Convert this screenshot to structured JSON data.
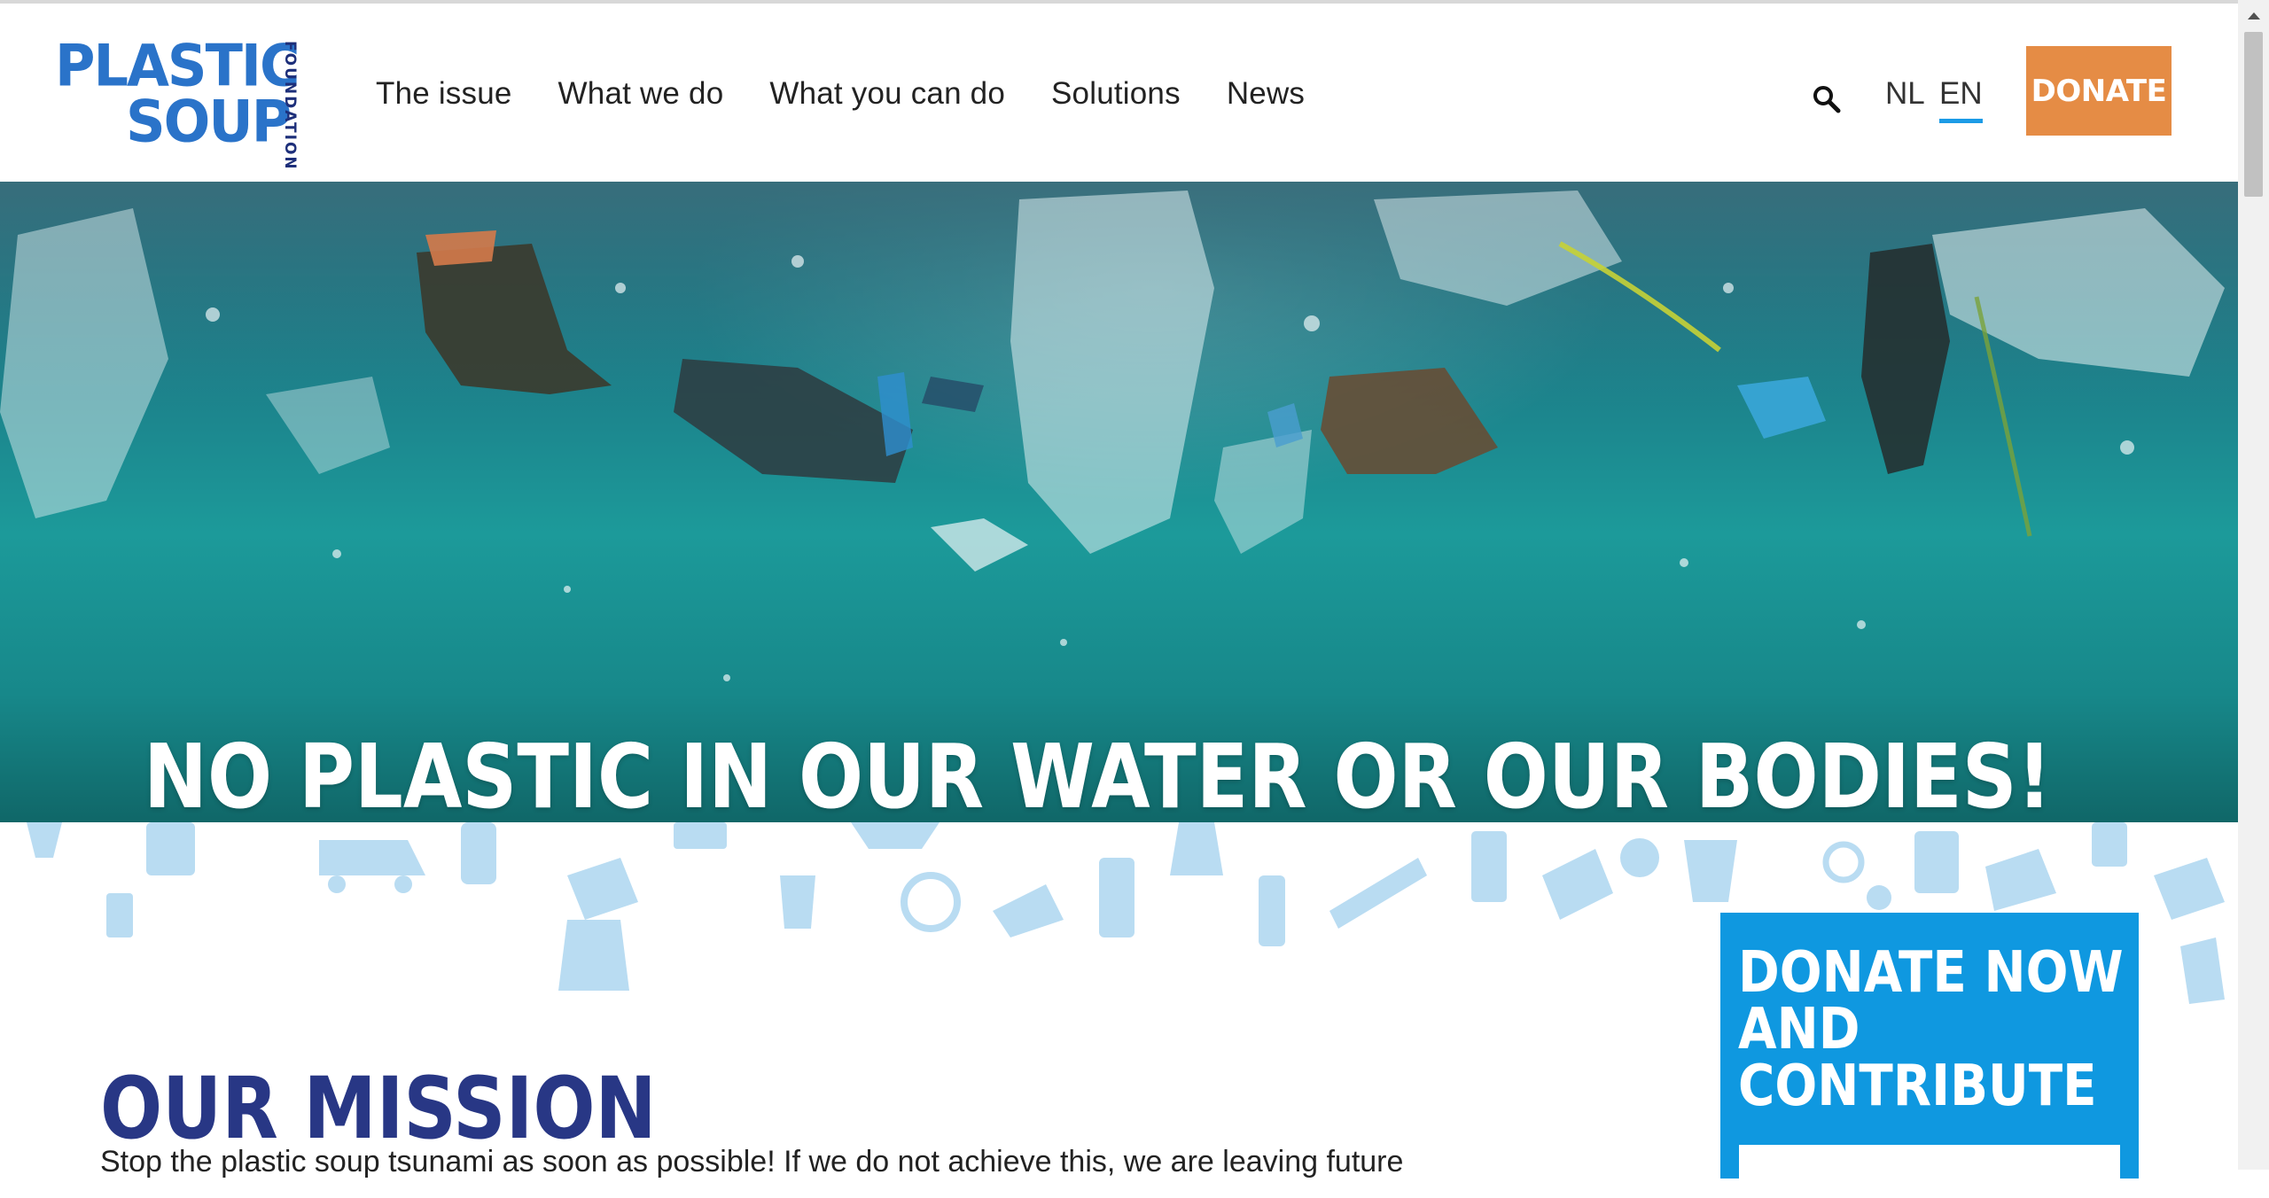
{
  "header": {
    "logo": {
      "line1": "PLASTIC",
      "line2": "SOUP",
      "vertical": "FOUNDATION"
    },
    "nav": [
      "The issue",
      "What we do",
      "What you can do",
      "Solutions",
      "News"
    ],
    "search_icon": "search-icon",
    "languages": {
      "nl": "NL",
      "en": "EN",
      "active": "EN"
    },
    "donate_label": "DONATE"
  },
  "hero": {
    "title": "NO PLASTIC IN OUR WATER OR OUR BODIES!"
  },
  "mission": {
    "title": "OUR MISSION",
    "text": "Stop the plastic soup tsunami as soon as possible! If we do not achieve this, we are leaving future"
  },
  "donate_box": {
    "title": "DONATE NOW\nAND\nCONTRIBUTE"
  },
  "colors": {
    "brand_blue": "#2a73c9",
    "navy": "#283785",
    "orange": "#e58c45",
    "accent_blue": "#0f98e0",
    "pattern_blue": "#b9dcf2"
  }
}
